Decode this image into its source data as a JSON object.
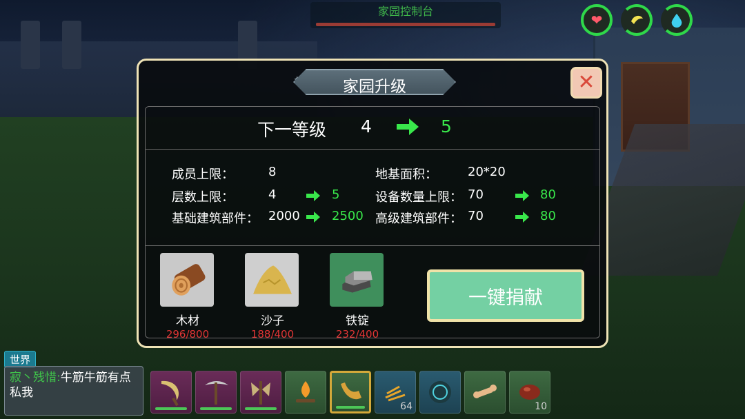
{
  "hud": {
    "target_name": "家园控制台",
    "status_icons": [
      "heart-icon",
      "food-icon",
      "water-drop-icon"
    ]
  },
  "dialog": {
    "title": "家园升级",
    "close_icon": "close-icon",
    "level": {
      "label": "下一等级",
      "from": "4",
      "to": "5"
    },
    "stats_left": [
      {
        "label": "成员上限：",
        "value": "8",
        "next": ""
      },
      {
        "label": "层数上限：",
        "value": "4",
        "next": "5"
      },
      {
        "label": "基础建筑部件：",
        "value": "2000",
        "next": "2500"
      }
    ],
    "stats_right": [
      {
        "label": "地基面积：",
        "value": "20*20",
        "next": ""
      },
      {
        "label": "设备数量上限：",
        "value": "70",
        "next": "80"
      },
      {
        "label": "高级建筑部件：",
        "value": "70",
        "next": "80"
      }
    ],
    "resources": [
      {
        "name": "木材",
        "count": "296/800",
        "icon": "wood-log-icon"
      },
      {
        "name": "沙子",
        "count": "188/400",
        "icon": "sand-pile-icon"
      },
      {
        "name": "铁锭",
        "count": "232/400",
        "icon": "iron-ingot-icon"
      }
    ],
    "donate_label": "一键捐献"
  },
  "chat": {
    "channel": "世界",
    "user": "寂丶残惜",
    "separator": ":",
    "message": "牛筋牛筋有点私我"
  },
  "hotbar": [
    {
      "icon": "sickle-icon",
      "count": ""
    },
    {
      "icon": "pickaxe-icon",
      "count": ""
    },
    {
      "icon": "battle-axe-icon",
      "count": ""
    },
    {
      "icon": "campfire-icon",
      "count": ""
    },
    {
      "icon": "horn-icon",
      "count": ""
    },
    {
      "icon": "fries-icon",
      "count": "64"
    },
    {
      "icon": "orb-icon",
      "count": ""
    },
    {
      "icon": "bone-icon",
      "count": ""
    },
    {
      "icon": "meat-icon",
      "count": "10"
    }
  ]
}
